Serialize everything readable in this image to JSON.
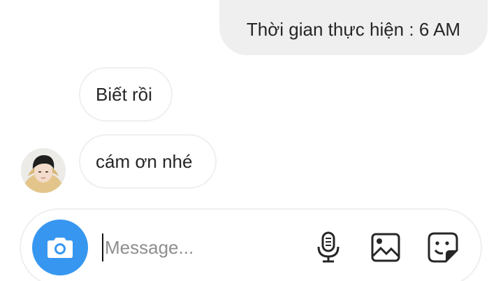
{
  "messages": {
    "outgoing": [
      {
        "text": "Thời gian thực hiện : 6 AM"
      }
    ],
    "incoming": [
      {
        "text": "Biết rồi"
      },
      {
        "text": "cám ơn nhé"
      }
    ]
  },
  "composer": {
    "placeholder": "Message...",
    "value": ""
  },
  "icons": {
    "camera": "camera-icon",
    "mic": "microphone-icon",
    "gallery": "image-icon",
    "sticker": "sticker-icon"
  },
  "colors": {
    "accent": "#3797f0",
    "bubble_out": "#efefef",
    "bubble_border": "#efefef"
  }
}
